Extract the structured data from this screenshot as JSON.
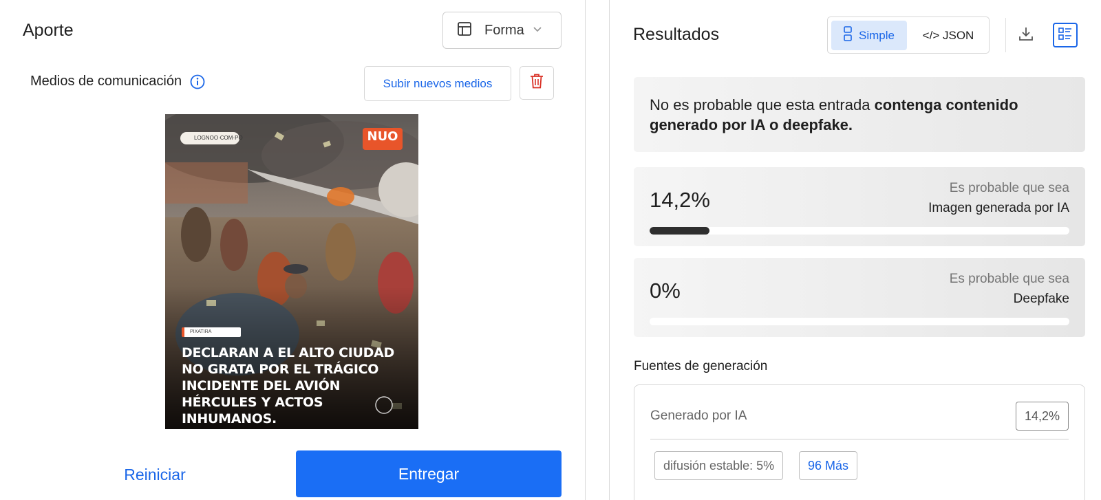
{
  "input_panel": {
    "title": "Aporte",
    "format_select": {
      "value": "Forma",
      "icon": "layout-icon"
    },
    "media_label": "Medios de comunicación",
    "upload_button": "Subir nuevos medios",
    "media_image": {
      "brand_text": "LOGNOO·COM·PO",
      "logo_text": "NUO",
      "tag_text": "PIXATIRA",
      "caption": "DECLARAN A EL ALTO CIUDAD NO GRATA POR EL TRÁGICO INCIDENTE DEL AVIÓN HÉRCULES Y ACTOS INHUMANOS."
    },
    "reset_button": "Reiniciar",
    "submit_button": "Entregar"
  },
  "results_panel": {
    "title": "Resultados",
    "view_toggle": {
      "simple": "Simple",
      "json": "</> JSON",
      "active": "simple"
    },
    "summary": {
      "prefix": "No es probable que esta entrada ",
      "highlight": "contenga contenido generado por IA o deepfake."
    },
    "scores": [
      {
        "value": "14,2%",
        "fraction": 0.142,
        "likely_label": "Es probable que sea",
        "type_label": "Imagen generada por IA"
      },
      {
        "value": "0%",
        "fraction": 0.0,
        "likely_label": "Es probable que sea",
        "type_label": "Deepfake"
      }
    ],
    "sources": {
      "title": "Fuentes de generación",
      "label": "Generado por IA",
      "percent": "14,2%",
      "chips": [
        "difusión estable: 5%",
        "96 Más"
      ]
    }
  },
  "colors": {
    "accent": "#1a6ef5",
    "link": "#1a66e8",
    "delete": "#d93025",
    "bar_fill": "#2e2e2e"
  }
}
